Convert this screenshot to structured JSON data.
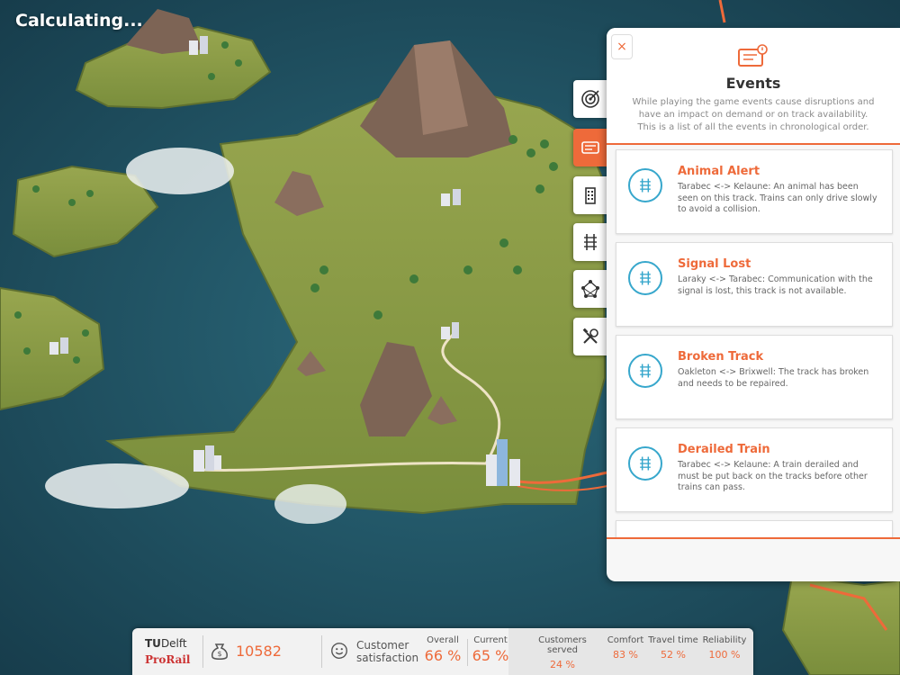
{
  "status": {
    "text": "Calculating..."
  },
  "panel": {
    "close_label": "×",
    "title": "Events",
    "description": "While playing the game events cause disruptions and have an impact on demand or on track availability. This is a list of all the events in chronological order.",
    "events": [
      {
        "title": "Animal Alert",
        "text": "Tarabec <-> Kelaune: An animal has been seen on this track. Trains can only drive slowly to avoid a collision."
      },
      {
        "title": "Signal Lost",
        "text": "Laraky <-> Tarabec: Communication with the signal is lost, this track is not available."
      },
      {
        "title": "Broken Track",
        "text": "Oakleton <-> Brixwell: The track has broken and needs to be repaired."
      },
      {
        "title": "Derailed Train",
        "text": "Tarabec <-> Kelaune: A train derailed and must be put back on the tracks before other trains can pass."
      }
    ]
  },
  "tabs": [
    {
      "icon": "target-icon"
    },
    {
      "icon": "events-ticket-icon",
      "active": true
    },
    {
      "icon": "building-icon"
    },
    {
      "icon": "rail-track-icon"
    },
    {
      "icon": "network-icon"
    },
    {
      "icon": "tools-icon"
    }
  ],
  "bottom": {
    "logo_tu": "TU",
    "logo_delft": "Delft",
    "logo_prorail": "ProRail",
    "money": "10582",
    "satisfaction_label_1": "Customer",
    "satisfaction_label_2": "satisfaction",
    "overall_label": "Overall",
    "overall_value": "66 %",
    "current_label": "Current",
    "current_value": "65 %",
    "customers_served_label": "Customers served",
    "customers_served_value": "24 %",
    "comfort_label": "Comfort",
    "comfort_value": "83 %",
    "travel_time_label": "Travel time",
    "travel_time_value": "52 %",
    "reliability_label": "Reliability",
    "reliability_value": "100 %"
  },
  "colors": {
    "accent": "#ee6a3a",
    "icon_blue": "#37a7cc",
    "sea": "#1f4d5e",
    "land": "#8a9a45"
  }
}
